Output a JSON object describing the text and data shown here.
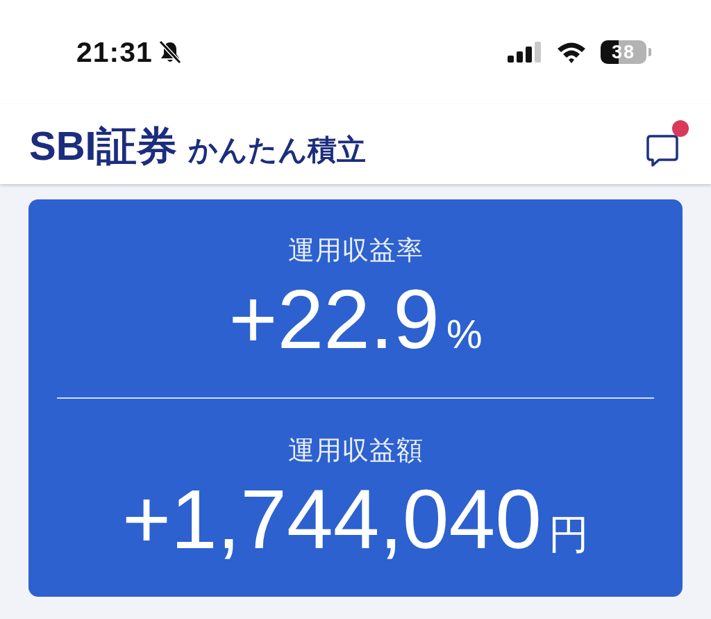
{
  "status_bar": {
    "time": "21:31",
    "silent": true,
    "battery": "38"
  },
  "header": {
    "brand": "SBI証券",
    "title": "かんたん積立",
    "unread": true
  },
  "summary": [
    {
      "label": "運用収益率",
      "value": "+22.9",
      "unit": "%"
    },
    {
      "label": "運用収益額",
      "value": "+1,744,040",
      "unit": "円"
    }
  ]
}
